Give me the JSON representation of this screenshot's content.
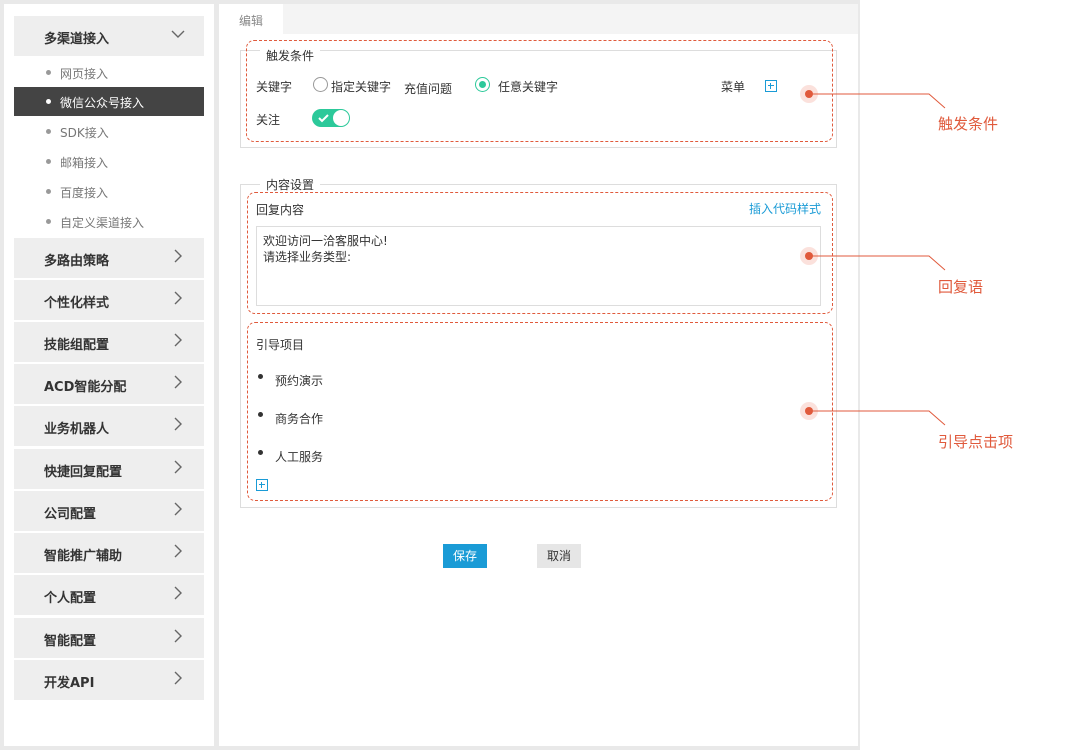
{
  "sidebar": {
    "groups": [
      {
        "label": "多渠道接入",
        "expanded": true
      },
      {
        "label": "多路由策略"
      },
      {
        "label": "个性化样式"
      },
      {
        "label": "技能组配置"
      },
      {
        "label": "ACD智能分配"
      },
      {
        "label": "业务机器人"
      },
      {
        "label": "快捷回复配置"
      },
      {
        "label": "公司配置"
      },
      {
        "label": "智能推广辅助"
      },
      {
        "label": "个人配置"
      },
      {
        "label": "智能配置"
      },
      {
        "label": "开发API"
      }
    ],
    "sub_items": [
      {
        "label": "网页接入"
      },
      {
        "label": "微信公众号接入",
        "active": true
      },
      {
        "label": "SDK接入"
      },
      {
        "label": "邮箱接入"
      },
      {
        "label": "百度接入"
      },
      {
        "label": "自定义渠道接入"
      }
    ]
  },
  "main": {
    "tab": "编辑",
    "trigger": {
      "legend": "触发条件",
      "keyword_label": "关键字",
      "option_specific": "指定关键字",
      "specific_value": "充值问题",
      "option_any": "任意关键字",
      "menu_label": "菜单",
      "follow_label": "关注"
    },
    "content": {
      "legend": "内容设置",
      "reply_label": "回复内容",
      "insert_code_link": "插入代码样式",
      "reply_text": "欢迎访问一洽客服中心!\n请选择业务类型:",
      "guide_label": "引导项目",
      "guide_items": [
        "预约演示",
        "商务合作",
        "人工服务"
      ]
    },
    "buttons": {
      "save": "保存",
      "cancel": "取消"
    }
  },
  "annotations": [
    "触发条件",
    "回复语",
    "引导点击项"
  ],
  "colors": {
    "accent": "#1a9bd6",
    "toggle": "#2cc99a",
    "annotation": "#e05a3c",
    "active_nav": "#444444"
  }
}
